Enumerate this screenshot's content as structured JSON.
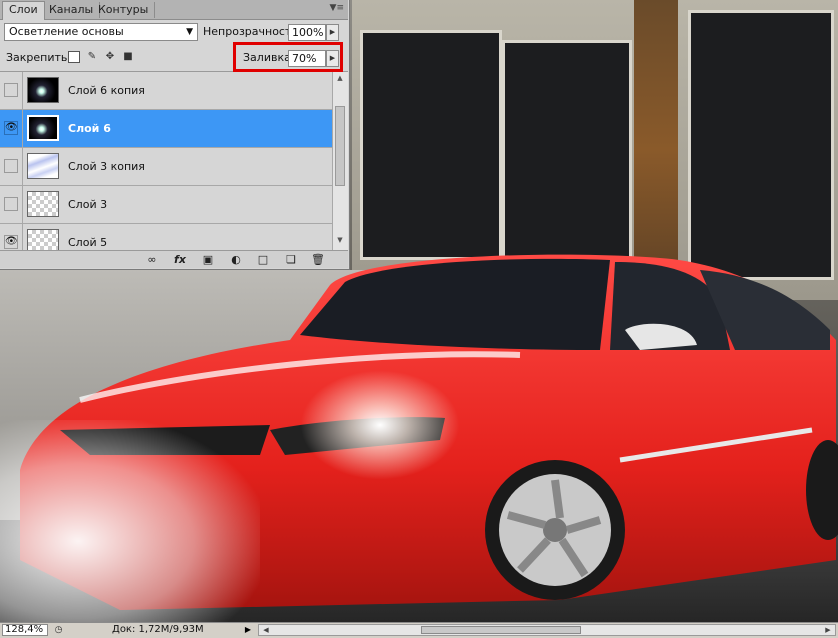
{
  "tabs": [
    "Слои",
    "Каналы",
    "Контуры"
  ],
  "blend_mode": "Осветление основы",
  "opacity_label": "Непрозрачность:",
  "opacity_value": "100%",
  "lock_label": "Закрепить:",
  "fill_label": "Заливка:",
  "fill_value": "70%",
  "layers": [
    {
      "name": "Слой 6 копия",
      "visible": false,
      "thumb": "dark",
      "selected": false
    },
    {
      "name": "Слой 6",
      "visible": true,
      "thumb": "dark",
      "selected": true
    },
    {
      "name": "Слой 3 копия",
      "visible": false,
      "thumb": "stroke",
      "selected": false
    },
    {
      "name": "Слой 3",
      "visible": false,
      "thumb": "checker",
      "selected": false
    },
    {
      "name": "Слой 5",
      "visible": true,
      "thumb": "checker",
      "selected": false
    }
  ],
  "status": {
    "zoom": "128,4%",
    "doc_info": "Док: 1,72M/9,93M"
  },
  "icons": {
    "eye": "eye-icon",
    "link": "link-layers-icon",
    "fx": "fx-icon",
    "mask": "add-mask-icon",
    "adjust": "adjustment-layer-icon",
    "folder": "new-group-icon",
    "new": "new-layer-icon",
    "trash": "delete-layer-icon"
  }
}
